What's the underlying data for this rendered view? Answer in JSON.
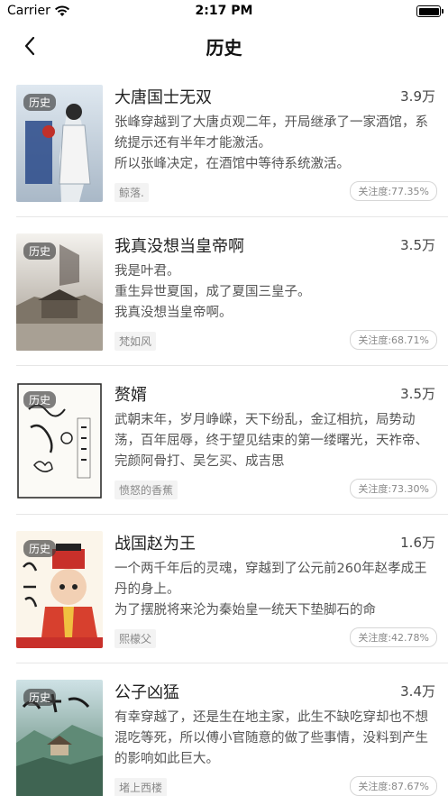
{
  "status_bar": {
    "carrier": "Carrier",
    "time": "2:17 PM"
  },
  "nav": {
    "title": "历史"
  },
  "books": [
    {
      "title": "大唐国士无双",
      "count": "3.9万",
      "tag": "历史",
      "description": "张峰穿越到了大唐贞观二年，开局继承了一家酒馆，系统提示还有半年才能激活。\n        所以张峰决定，在酒馆中等待系统激活。",
      "author": "鲸落.",
      "attention": "关注度:77.35%"
    },
    {
      "title": "我真没想当皇帝啊",
      "count": "3.5万",
      "tag": "历史",
      "description": "我是叶君。\n重生异世夏国，成了夏国三皇子。\n我真没想当皇帝啊。",
      "author": "梵如风",
      "attention": "关注度:68.71%"
    },
    {
      "title": "赘婿",
      "count": "3.5万",
      "tag": "历史",
      "description": "武朝末年，岁月峥嵘，天下纷乱，金辽相抗，局势动荡，百年屈辱，终于望见结束的第一缕曙光，天祚帝、完颜阿骨打、吴乞买、成吉思",
      "author": "愤怒的香蕉",
      "attention": "关注度:73.30%"
    },
    {
      "title": "战国赵为王",
      "count": "1.6万",
      "tag": "历史",
      "description": "一个两千年后的灵魂，穿越到了公元前260年赵孝成王丹的身上。\n为了摆脱将来沦为秦始皇一统天下垫脚石的命",
      "author": "熙檬父",
      "attention": "关注度:42.78%"
    },
    {
      "title": "公子凶猛",
      "count": "3.4万",
      "tag": "历史",
      "description": "有幸穿越了，还是生在地主家，此生不缺吃穿却也不想混吃等死，所以傅小官随意的做了些事情，没料到产生的影响如此巨大。",
      "author": "堵上西楼",
      "attention": "关注度:87.67%"
    }
  ]
}
